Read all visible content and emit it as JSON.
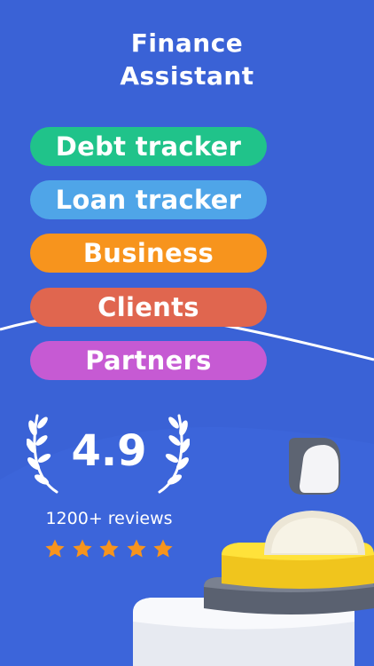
{
  "header": {
    "title_line1": "Finance",
    "title_line2": "Assistant"
  },
  "features": [
    {
      "label": "Debt tracker",
      "color": "#20c38a"
    },
    {
      "label": "Loan tracker",
      "color": "#4fa5e8"
    },
    {
      "label": "Business",
      "color": "#f7941d"
    },
    {
      "label": "Clients",
      "color": "#e0664f"
    },
    {
      "label": "Partners",
      "color": "#c65ad3"
    }
  ],
  "rating": {
    "score": "4.9",
    "reviews_text": "1200+ reviews",
    "stars": 5,
    "star_color": "#f7941d"
  },
  "colors": {
    "background": "#3a62d6",
    "text": "#ffffff"
  }
}
